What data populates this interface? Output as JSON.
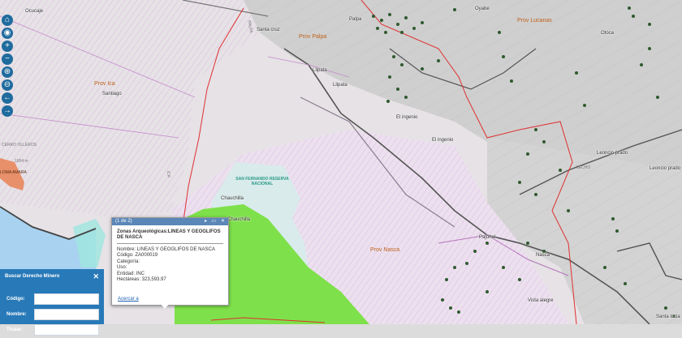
{
  "map": {
    "provinces": [
      "Prov Ica",
      "Prov Palpa",
      "Prov Lucanas",
      "Prov Nasca"
    ],
    "places": [
      "Ocucaje",
      "Santiago",
      "Santa cruz",
      "Palpa",
      "Llipata",
      "Llipata",
      "Oyabe",
      "Otoca",
      "El ingenio",
      "El ingenio",
      "Leoncio prado",
      "Leoncio prado",
      "Nasca",
      "Vista alegre",
      "Santa lucia",
      "Chauchilla",
      "Chauchilla",
      "Pajonal"
    ],
    "faint_labels": [
      "CERRO OLLEROS",
      "1004 m",
      "LOMA AMARA",
      "PALPA",
      "ICA",
      "LECHO"
    ],
    "reserve_label": "SAN FERNANDO RESERVA NACIONAL",
    "colors": {
      "boundary": "#e03030",
      "route": "#6e6e6e",
      "reserve_fill": "#7ee04a",
      "marker": "#2f5a2f",
      "panel": "#2879b8",
      "popup_header": "#5b87b8"
    }
  },
  "toolbar": {
    "icons": [
      "home-icon",
      "locate-icon",
      "zoom-in-icon",
      "zoom-out-icon",
      "zoom-box-in-icon",
      "zoom-box-out-icon",
      "back-arrow-icon",
      "forward-arrow-icon"
    ],
    "glyphs": [
      "⌂",
      "◉",
      "+",
      "−",
      "⊕",
      "⊖",
      "←",
      "→"
    ]
  },
  "popup": {
    "page": "(1 de 2)",
    "controls": [
      "▸",
      "▭",
      "✕"
    ],
    "title": "Zonas Arqueológicas:LINEAS Y GEOGLIFOS DE NASCA",
    "nombre": "Nombre: LINEAS Y GEOGLIFOS DE NASCA",
    "codigo": "Código: ZA000019",
    "categoria": "Categoría:",
    "uso": "Uso:",
    "entidad": "Entidad: INC",
    "hectareas": "Hectáreas: 323,593.97",
    "link": "Acercar a"
  },
  "search_panel": {
    "title": "Buscar Derecho Minero",
    "close": "✕",
    "codigo_label": "Código:",
    "nombre_label": "Nombre:",
    "titular_label": "Titular:"
  }
}
